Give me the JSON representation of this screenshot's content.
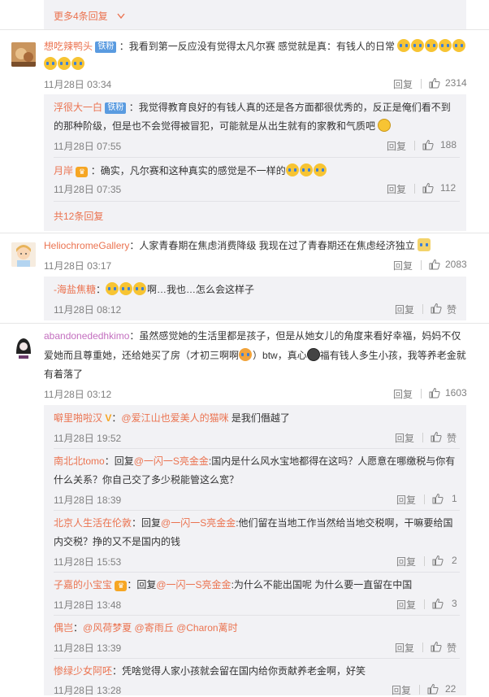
{
  "top_more": {
    "label": "更多4条回复"
  },
  "c1": {
    "name": "想吃辣鸭头",
    "badge": "铁粉",
    "text1": "：我看到第一反应没有觉得太凡尔赛 感觉就是真：有钱人的日常",
    "time": "11月28日 03:34",
    "reply": "回复",
    "likes": "2314",
    "replies": [
      {
        "name": "浮很大一白",
        "badge": "铁粉",
        "text1": "：我觉得教育良好的有钱人真的还是各方面都很优秀的，反正是俺们看不到",
        "text2": "的那种阶级，但是也不会觉得被冒犯，可能就是从出生就有的家教和气质吧",
        "time": "11月28日 07:55",
        "reply": "回复",
        "likes": "188"
      },
      {
        "name": "月岸",
        "text1": "：确实，凡尔赛和这种真实的感觉是不一样的",
        "time": "11月28日 07:35",
        "reply": "回复",
        "likes": "112"
      }
    ],
    "more": "共12条回复"
  },
  "c2": {
    "name": "HeliochromeGallery",
    "text1": "：人家青春期在焦虑消费降级 我现在过了青春期还在焦虑经济独立",
    "time": "11月28日 03:17",
    "reply": "回复",
    "likes": "2083",
    "replies": [
      {
        "name": "-海盐焦糖",
        "text1": "：",
        "text_after": "啊…我也…怎么会这样子",
        "time": "11月28日 08:12",
        "reply": "回复",
        "likes": "赞"
      }
    ]
  },
  "c3": {
    "name": "abandonededhkimo",
    "text1": "：虽然感觉她的生活里都是孩子，但是从她女儿的角度来看好幸福，妈妈不仅",
    "text2a": "爱她而且尊重她，还给她买了房（才初三啊啊",
    "text2b": "）btw，真心",
    "text2c": "福有钱人多生小孩，我等养老金就",
    "text3": "有着落了",
    "time": "11月28日 03:12",
    "reply": "回复",
    "likes": "1603",
    "replies": [
      {
        "name": "噼里啪啦汉",
        "mention": "@爱江山也爱美人的猫咪",
        "text1": " 是我们僭越了",
        "time": "11月28日 19:52",
        "reply": "回复",
        "likes": "赞"
      },
      {
        "name": "南北北tomo",
        "pre": "：回复",
        "mention": "@一闪一S亮金金",
        "text1": ":国内是什么风水宝地都得在这吗？人愿意在哪缴税与你有",
        "text2": "什么关系？你自己交了多少税能管这么宽？",
        "time": "11月28日 18:39",
        "reply": "回复",
        "likes": "1"
      },
      {
        "name": "北京人生活在伦敦",
        "pre": "：回复",
        "mention": "@一闪一S亮金金",
        "text1": ":他们留在当地工作当然给当地交税啊，干嘛要给国",
        "text2": "内交税？挣的又不是国内的钱",
        "time": "11月28日 15:53",
        "reply": "回复",
        "likes": "2"
      },
      {
        "name": "子嘉的小宝宝",
        "pre": "：回复",
        "mention": "@一闪一S亮金金",
        "text1": ":为什么不能出国呢 为什么要一直留在中国",
        "time": "11月28日 13:48",
        "reply": "回复",
        "likes": "3"
      },
      {
        "name": "偶岂",
        "pre": "：",
        "mention": "@风荷梦夏 @寄雨丘 @Charon蓠时",
        "text1": "",
        "time": "11月28日 13:39",
        "reply": "回复",
        "likes": "赞"
      },
      {
        "name": "惨绿少女阿呸",
        "text1": "：凭啥觉得人家小孩就会留在国内给你贡献养老金啊，好笑",
        "time": "11月28日 13:28",
        "reply": "回复",
        "likes": "22"
      }
    ]
  },
  "colors": {
    "name": "#eb7350",
    "name_purple": "#c36fbf",
    "link": "#eb7350",
    "meta": "#808080",
    "box": "#f2f2f5"
  }
}
